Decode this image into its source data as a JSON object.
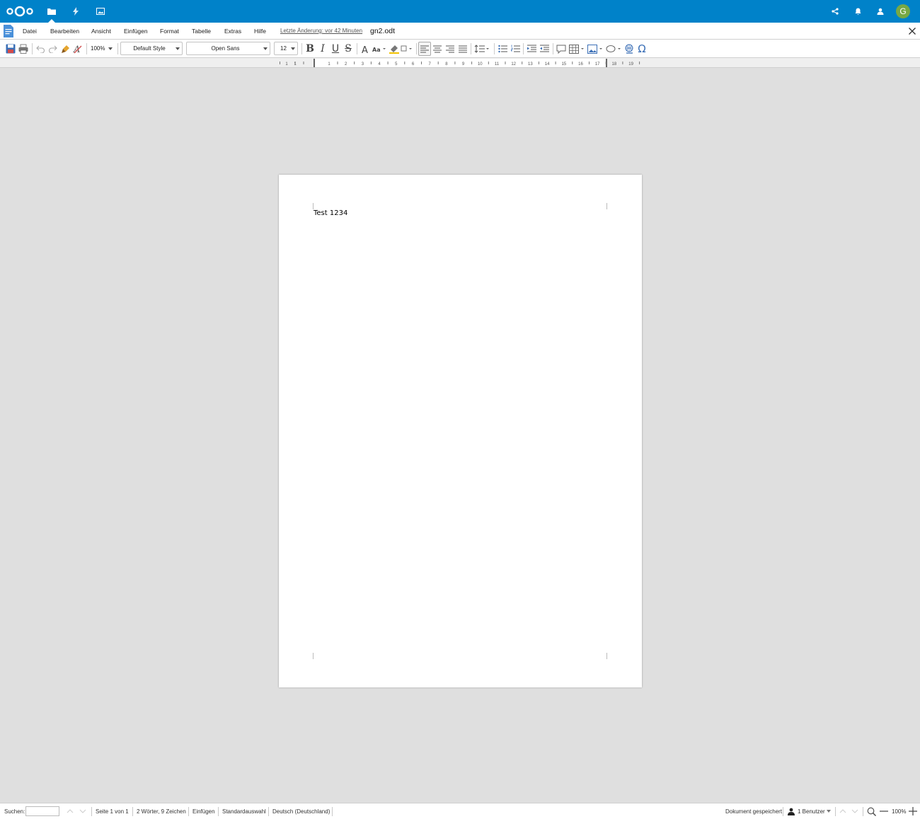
{
  "nc_header": {
    "apps": [
      {
        "name": "files-app-icon"
      },
      {
        "name": "activity-app-icon"
      },
      {
        "name": "gallery-app-icon"
      }
    ],
    "avatar_letter": "G",
    "brand_color": "#0082c9"
  },
  "menubar": {
    "items": [
      "Datei",
      "Bearbeiten",
      "Ansicht",
      "Einfügen",
      "Format",
      "Tabelle",
      "Extras",
      "Hilfe"
    ],
    "last_change": "Letzte Änderung: vor 42 Minuten",
    "doc_name": "gn2.odt"
  },
  "toolbar": {
    "zoom": "100%",
    "style": "Default Style",
    "font": "Open Sans",
    "size": "12"
  },
  "ruler": {
    "ticks": [
      "1",
      "1",
      "1",
      "2",
      "3",
      "4",
      "5",
      "6",
      "7",
      "8",
      "9",
      "10",
      "11",
      "12",
      "13",
      "14",
      "15",
      "16",
      "17",
      "18",
      "19"
    ]
  },
  "document": {
    "text": "Test 1234"
  },
  "statusbar": {
    "search_label": "Suchen:",
    "page": "Seite 1 von 1",
    "words": "2 Wörter, 9 Zeichen",
    "mode": "Einfügen",
    "selection": "Standardauswahl",
    "language": "Deutsch (Deutschland)",
    "saved": "Dokument gespeichert",
    "users": "1 Benutzer",
    "zoom": "100%"
  }
}
